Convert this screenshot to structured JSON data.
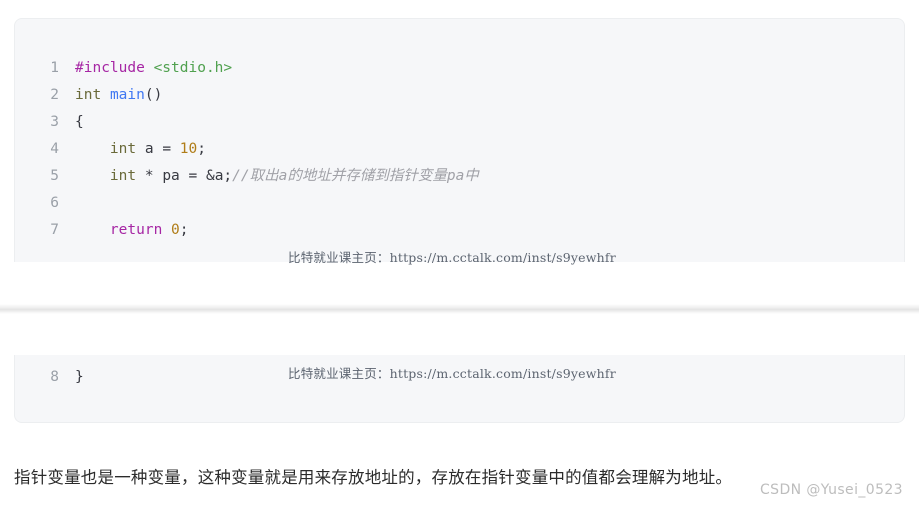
{
  "page": {
    "background_color": "#ffffff",
    "body_paragraph": "指针变量也是一种变量，这种变量就是用来存放地址的，存放在指针变量中的值都会理解为地址。",
    "csdn_watermark": "CSDN @Yusei_0523"
  },
  "watermark": {
    "text": "比特就业课主页：https://m.cctalk.com/inst/s9yewhfr",
    "color": "#5c6470"
  },
  "code_block_1": {
    "background_color": "#f6f7f9",
    "language": "c",
    "lines": [
      {
        "number": "1",
        "tokens": [
          {
            "text": "#include",
            "cls": "t-pre"
          },
          {
            "text": " ",
            "cls": "t-punc"
          },
          {
            "text": "<stdio.h>",
            "cls": "t-str"
          }
        ]
      },
      {
        "number": "2",
        "tokens": [
          {
            "text": "int",
            "cls": "t-type"
          },
          {
            "text": " ",
            "cls": "t-punc"
          },
          {
            "text": "main",
            "cls": "t-fn"
          },
          {
            "text": "()",
            "cls": "t-punc"
          }
        ]
      },
      {
        "number": "3",
        "tokens": [
          {
            "text": "{",
            "cls": "t-punc"
          }
        ]
      },
      {
        "number": "4",
        "tokens": [
          {
            "text": "    ",
            "cls": "t-punc"
          },
          {
            "text": "int",
            "cls": "t-type"
          },
          {
            "text": " a = ",
            "cls": "t-var"
          },
          {
            "text": "10",
            "cls": "t-num"
          },
          {
            "text": ";",
            "cls": "t-punc"
          }
        ]
      },
      {
        "number": "5",
        "tokens": [
          {
            "text": "    ",
            "cls": "t-punc"
          },
          {
            "text": "int",
            "cls": "t-type"
          },
          {
            "text": " * pa = &a;",
            "cls": "t-var"
          },
          {
            "text": "//取出a的地址并存储到指针变量pa中",
            "cls": "t-cmt"
          }
        ]
      },
      {
        "number": "6",
        "tokens": [
          {
            "text": "",
            "cls": "t-punc"
          }
        ]
      },
      {
        "number": "7",
        "tokens": [
          {
            "text": "    ",
            "cls": "t-punc"
          },
          {
            "text": "return",
            "cls": "t-kw"
          },
          {
            "text": " ",
            "cls": "t-punc"
          },
          {
            "text": "0",
            "cls": "t-num"
          },
          {
            "text": ";",
            "cls": "t-punc"
          }
        ]
      }
    ]
  },
  "code_block_2": {
    "background_color": "#f6f7f9",
    "language": "c",
    "lines": [
      {
        "number": "8",
        "tokens": [
          {
            "text": "}",
            "cls": "t-punc"
          }
        ]
      }
    ]
  }
}
